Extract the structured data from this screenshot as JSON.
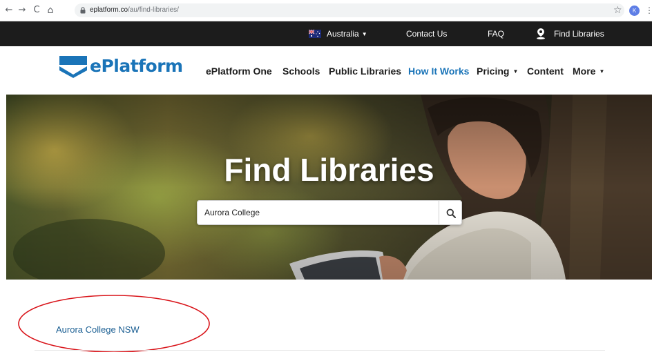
{
  "browser": {
    "url_host": "eplatform.co",
    "url_path": "/au/find-libraries/",
    "back_glyph": "←",
    "forward_glyph": "→",
    "reload_glyph": "C",
    "home_glyph": "⌂",
    "star_glyph": "☆",
    "profile_initial": "K",
    "menu_glyph": "⋮"
  },
  "top_bar": {
    "region_label": "Australia",
    "contact_label": "Contact Us",
    "faq_label": "FAQ",
    "find_libraries_label": "Find Libraries",
    "caret_glyph": "▼"
  },
  "nav": {
    "logo_text": "ePlatform",
    "items": [
      {
        "label": "ePlatform One"
      },
      {
        "label": "Schools"
      },
      {
        "label": "Public Libraries"
      },
      {
        "label": "How It Works"
      },
      {
        "label": "Pricing"
      },
      {
        "label": "Content"
      },
      {
        "label": "More"
      }
    ],
    "caret_glyph": "▼"
  },
  "hero": {
    "title": "Find Libraries",
    "search_value": "Aurora College"
  },
  "results": {
    "items": [
      {
        "label": "Aurora College NSW"
      }
    ]
  },
  "colors": {
    "brand_blue": "#1a74b8",
    "top_bar": "#1c1c1c",
    "annotation_red": "#d9141a",
    "link_blue": "#1a5e92"
  }
}
